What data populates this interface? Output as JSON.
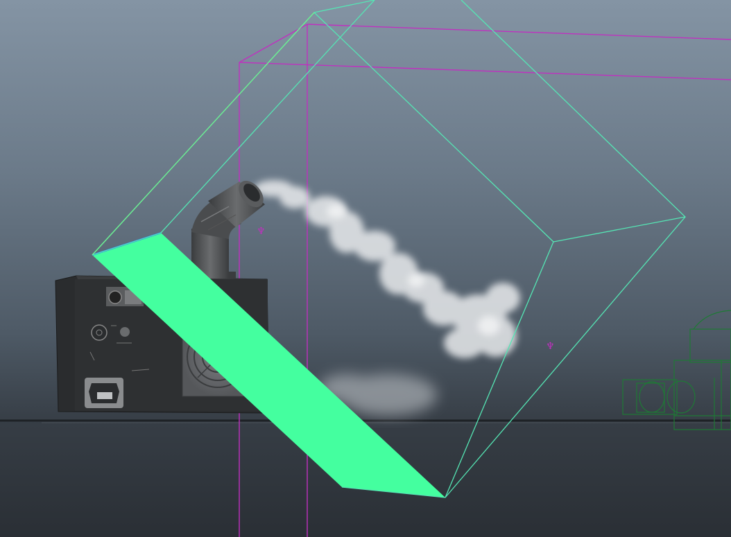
{
  "viewport": {
    "kind": "3d-perspective-viewport",
    "colors": {
      "sky_top": "#8494a4",
      "sky_bottom": "#2a2f35",
      "ground_line": "#1d2125",
      "fluid_container": "#55e6b4",
      "selected_plane": "#44ff9f",
      "camera_frustum": "#c030c0",
      "emitter_marker": "#c030c0",
      "wire_object": "#1e7a35",
      "smoke": "#e8eaec",
      "machine_body": "#2a2c2e",
      "machine_fan_panel": "#6b6d70"
    },
    "objects": [
      {
        "name": "fog-machine",
        "icon": "fog-machine-model"
      },
      {
        "name": "nozzle-pipe",
        "icon": "elbow-pipe"
      },
      {
        "name": "fluid-container",
        "icon": "wireframe-box"
      },
      {
        "name": "smoke-plume",
        "icon": "smoke"
      },
      {
        "name": "emitter",
        "icon": "emitter-marker"
      },
      {
        "name": "camera-frustum",
        "icon": "camera-lines"
      },
      {
        "name": "wire-object",
        "icon": "wireframe-mesh"
      }
    ]
  }
}
